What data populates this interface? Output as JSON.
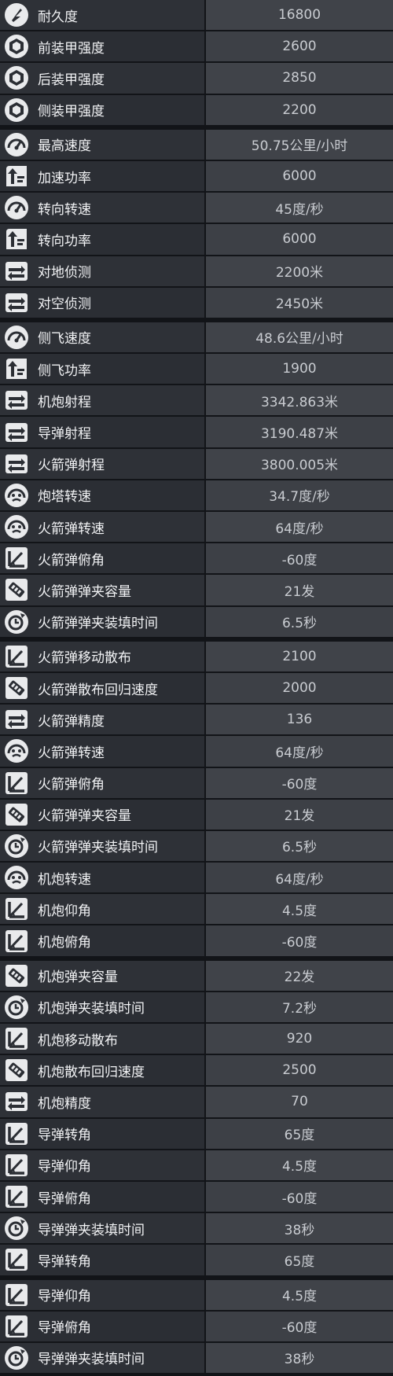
{
  "stats": [
    {
      "icon": "durability-icon",
      "label": "耐久度",
      "value": "16800"
    },
    {
      "icon": "armor-icon",
      "label": "前装甲强度",
      "value": "2600"
    },
    {
      "icon": "armor-icon",
      "label": "后装甲强度",
      "value": "2850"
    },
    {
      "icon": "armor-icon",
      "label": "侧装甲强度",
      "value": "2200"
    },
    {
      "icon": "speedometer-icon",
      "label": "最高速度",
      "value": "50.75公里/小时"
    },
    {
      "icon": "power-icon",
      "label": "加速功率",
      "value": "6000"
    },
    {
      "icon": "speedometer-icon",
      "label": "转向转速",
      "value": "45度/秒"
    },
    {
      "icon": "power-icon",
      "label": "转向功率",
      "value": "6000"
    },
    {
      "icon": "range-icon",
      "label": "对地侦测",
      "value": "2200米"
    },
    {
      "icon": "range-icon",
      "label": "对空侦测",
      "value": "2450米"
    },
    {
      "icon": "speedometer-icon",
      "label": "侧飞速度",
      "value": "48.6公里/小时"
    },
    {
      "icon": "power-icon",
      "label": "侧飞功率",
      "value": "1900"
    },
    {
      "icon": "range-icon",
      "label": "机炮射程",
      "value": "3342.863米"
    },
    {
      "icon": "range-icon",
      "label": "导弹射程",
      "value": "3190.487米"
    },
    {
      "icon": "range-icon",
      "label": "火箭弹射程",
      "value": "3800.005米"
    },
    {
      "icon": "turret-icon",
      "label": "炮塔转速",
      "value": "34.7度/秒"
    },
    {
      "icon": "turret-icon",
      "label": "火箭弹转速",
      "value": "64度/秒"
    },
    {
      "icon": "angle-icon",
      "label": "火箭弹俯角",
      "value": "-60度"
    },
    {
      "icon": "magazine-icon",
      "label": "火箭弹弹夹容量",
      "value": "21发"
    },
    {
      "icon": "reload-icon",
      "label": "火箭弹弹夹装填时间",
      "value": "6.5秒"
    },
    {
      "icon": "angle-icon",
      "label": "火箭弹移动散布",
      "value": "2100"
    },
    {
      "icon": "magazine-icon",
      "label": "火箭弹散布回归速度",
      "value": "2000"
    },
    {
      "icon": "range-icon",
      "label": "火箭弹精度",
      "value": "136"
    },
    {
      "icon": "turret-icon",
      "label": "火箭弹转速",
      "value": "64度/秒"
    },
    {
      "icon": "angle-icon",
      "label": "火箭弹俯角",
      "value": "-60度"
    },
    {
      "icon": "magazine-icon",
      "label": "火箭弹弹夹容量",
      "value": "21发"
    },
    {
      "icon": "reload-icon",
      "label": "火箭弹弹夹装填时间",
      "value": "6.5秒"
    },
    {
      "icon": "turret-icon",
      "label": "机炮转速",
      "value": "64度/秒"
    },
    {
      "icon": "angle-icon",
      "label": "机炮仰角",
      "value": "4.5度"
    },
    {
      "icon": "angle-icon",
      "label": "机炮俯角",
      "value": "-60度"
    },
    {
      "icon": "magazine-icon",
      "label": "机炮弹夹容量",
      "value": "22发"
    },
    {
      "icon": "reload-icon",
      "label": "机炮弹夹装填时间",
      "value": "7.2秒"
    },
    {
      "icon": "angle-icon",
      "label": "机炮移动散布",
      "value": "920"
    },
    {
      "icon": "magazine-icon",
      "label": "机炮散布回归速度",
      "value": "2500"
    },
    {
      "icon": "range-icon",
      "label": "机炮精度",
      "value": "70"
    },
    {
      "icon": "angle-icon",
      "label": "导弹转角",
      "value": "65度"
    },
    {
      "icon": "angle-icon",
      "label": "导弹仰角",
      "value": "4.5度"
    },
    {
      "icon": "angle-icon",
      "label": "导弹俯角",
      "value": "-60度"
    },
    {
      "icon": "reload-icon",
      "label": "导弹弹夹装填时间",
      "value": "38秒"
    },
    {
      "icon": "angle-icon",
      "label": "导弹转角",
      "value": "65度"
    },
    {
      "icon": "angle-icon",
      "label": "导弹仰角",
      "value": "4.5度"
    },
    {
      "icon": "angle-icon",
      "label": "导弹俯角",
      "value": "-60度"
    },
    {
      "icon": "reload-icon",
      "label": "导弹弹夹装填时间",
      "value": "38秒"
    }
  ]
}
